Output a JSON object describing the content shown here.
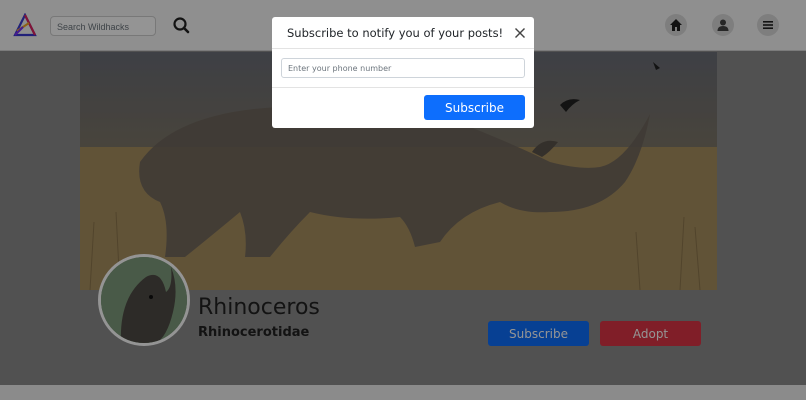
{
  "navbar": {
    "search_placeholder": "Search Wildhacks"
  },
  "profile": {
    "name": "Rhinoceros",
    "family": "Rhinocerotidae",
    "subscribe_label": "Subscribe",
    "adopt_label": "Adopt"
  },
  "modal": {
    "title": "Subscribe to notify you of your posts!",
    "phone_placeholder": "Enter your phone number",
    "phone_value": "",
    "submit_label": "Subscribe"
  },
  "colors": {
    "primary": "#0d6efd",
    "danger": "#dc3545"
  },
  "icons": [
    "app-logo-icon",
    "search-icon",
    "home-icon",
    "user-icon",
    "menu-icon",
    "close-icon"
  ]
}
